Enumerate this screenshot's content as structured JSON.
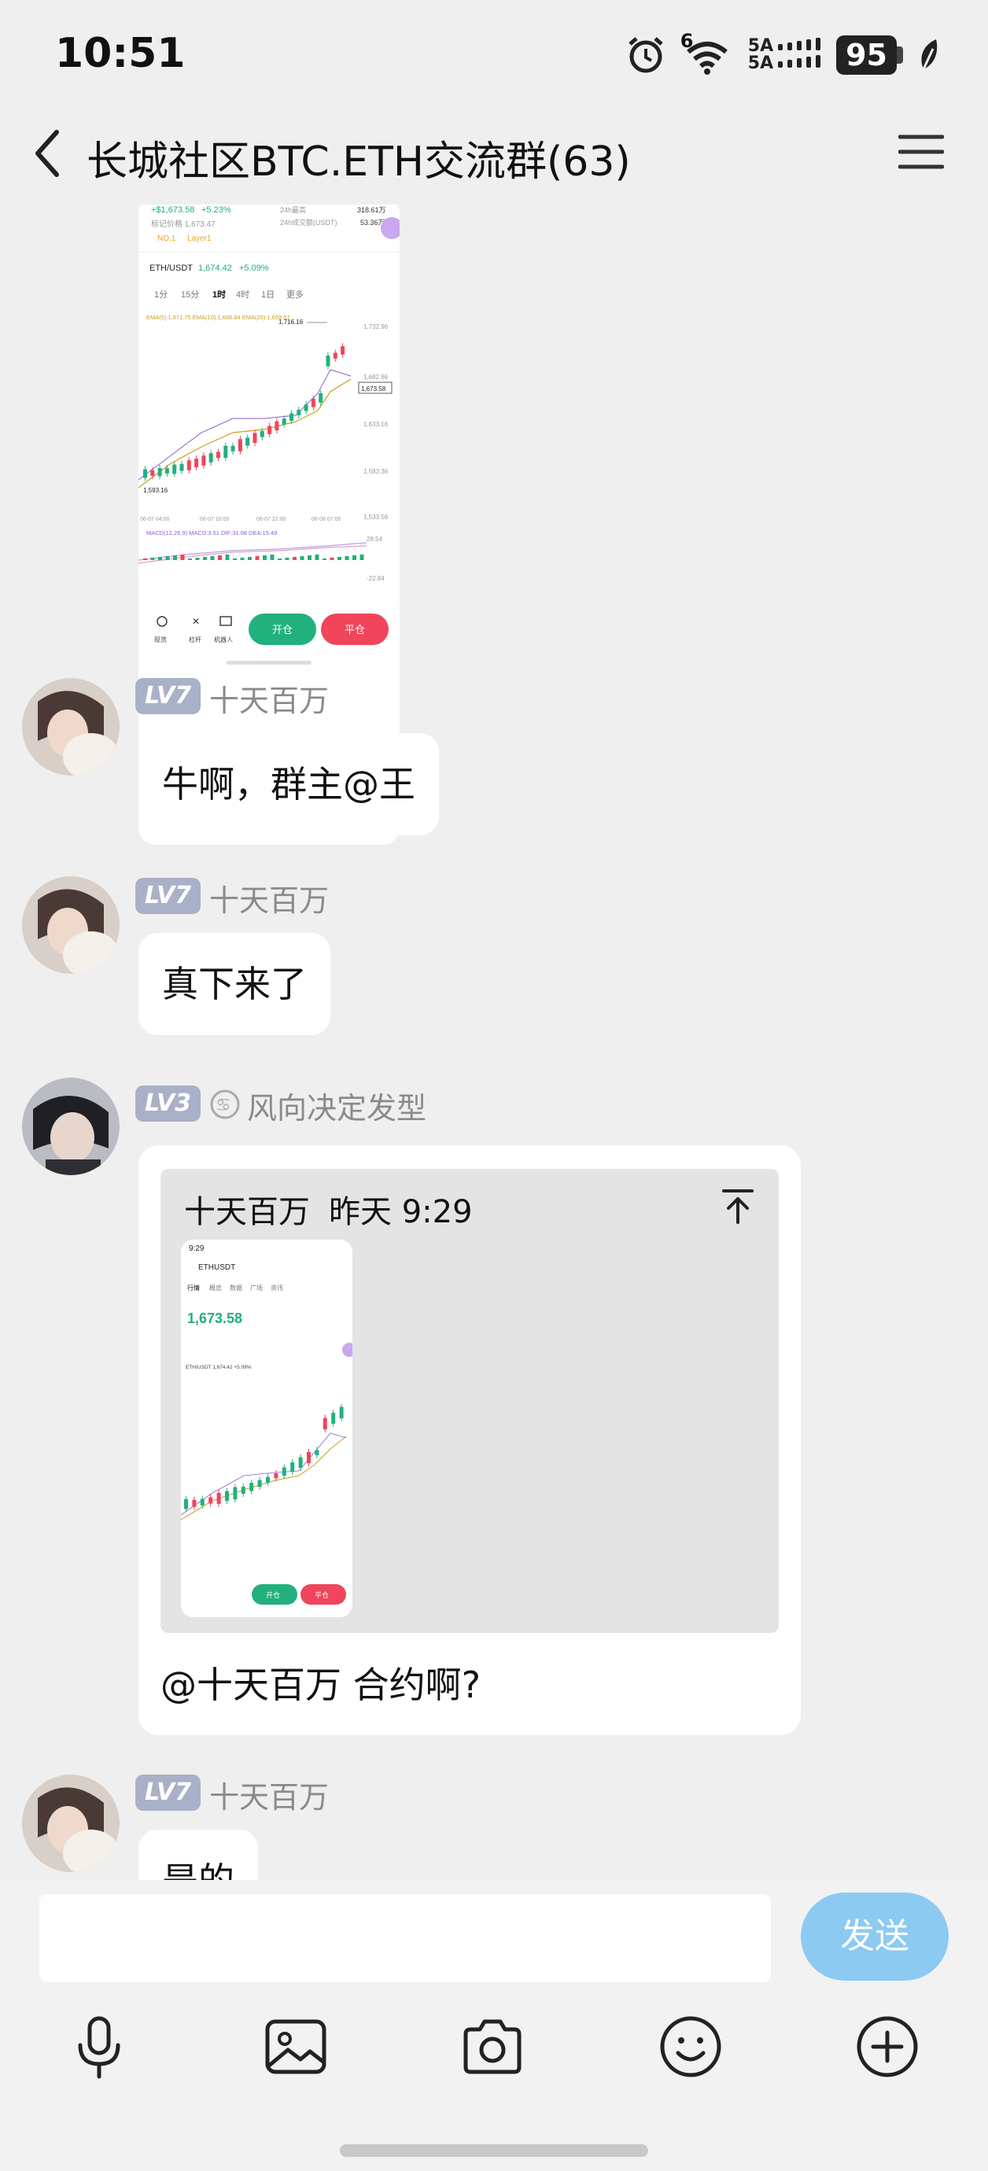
{
  "status_bar": {
    "time": "10:51",
    "network_top": "5A",
    "network_bottom": "5A",
    "wifi_label": "6",
    "battery": "95"
  },
  "header": {
    "title": "长城社区BTC.ETH交流群(63)"
  },
  "shared_image": {
    "top_price": "+$1,673.58",
    "top_change": "+5.23%",
    "top_sub": "标记价格 1,673.47",
    "rank": "NO.1",
    "layer": "Layer1",
    "right_stat1": "24h最高",
    "right_stat1_val": "318.61万",
    "right_stat2": "24h成交额(USDT)",
    "right_stat2_val": "53.36万",
    "pair": "ETH/USDT",
    "pair_price": "1,674.42",
    "pair_change": "+5.09%",
    "tabs": [
      "1分",
      "15分",
      "1时",
      "4时",
      "1日",
      "更多"
    ],
    "ema_line": "EMA(5):1,671.75  EMA(10):1,668.84  EMA(20):1,659.57",
    "high_label": "1,716.16",
    "price_ticks": [
      "1,732.96",
      "1,682.86",
      "1,633.16",
      "1,583.36",
      "1,533.56"
    ],
    "current_price_tag": "1,673.58",
    "low_label": "1,593.16",
    "time_labels": [
      "06-07 04:00",
      "06-07 10:00",
      "06-07 22:00",
      "06-08 07:00"
    ],
    "macd_line": "MACD(12,26,9)  MACD:3.51  DIF:31.08  DEA:15.49",
    "macd_ticks": [
      "28.54",
      "-22.84"
    ],
    "bottom_icons": [
      "现货",
      "杠杆",
      "机器人"
    ],
    "open_label": "开仓",
    "close_label": "平仓"
  },
  "messages": [
    {
      "level": "LV7",
      "sender": "十天百万",
      "text": "牛啊，群主@王"
    },
    {
      "level": "LV7",
      "sender": "十天百万",
      "text": "真下来了"
    },
    {
      "level": "LV3",
      "sender": "风向决定发型",
      "quote_sender": "十天百万",
      "quote_time": "昨天 9:29",
      "quote_thumb": {
        "time": "9:29",
        "pair": "ETHUSDT",
        "tabs": [
          "行情",
          "概览",
          "数据",
          "广场",
          "资讯"
        ],
        "price": "1,673.58",
        "pair_line": "ETH/USDT  1,674.42 +5.09%",
        "open_label": "开仓",
        "close_label": "平仓"
      },
      "text": "@十天百万  合约啊?"
    },
    {
      "level": "LV7",
      "sender": "十天百万",
      "text": "是的"
    }
  ],
  "input": {
    "placeholder": "",
    "send_label": "发送"
  },
  "toolbar_icons": [
    "microphone-icon",
    "image-icon",
    "camera-icon",
    "emoji-icon",
    "plus-icon"
  ],
  "colors": {
    "send_button": "#8ccaf2",
    "level_badge": "#a9b1c8",
    "up_candle": "#22b07d",
    "down_candle": "#f0455a"
  }
}
